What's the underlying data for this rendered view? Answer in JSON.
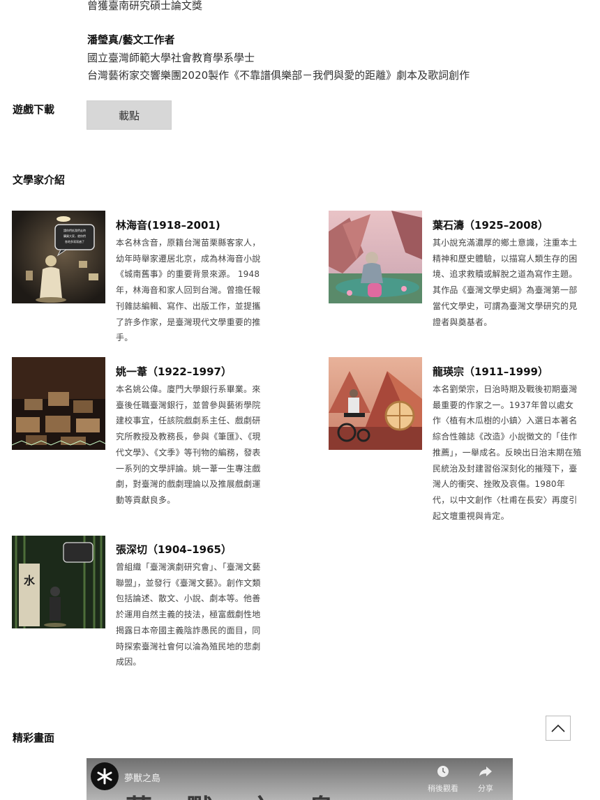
{
  "credits": {
    "line_award": "曾獲臺南研究碩士論文獎",
    "person2_name": "潘瑩真/藝文工作者",
    "person2_line1": "國立臺灣師範大學社會教育學系學士",
    "person2_line2": "台灣藝術家交響樂團2020製作《不靠譜俱樂部－我們與愛的距離》劇本及歌詞創作"
  },
  "download": {
    "label": "遊戲下載",
    "button_label": "載點"
  },
  "authors_section": {
    "title": "文學家介紹",
    "authors": [
      {
        "name": "林海音(1918–2001)",
        "desc": "本名林含音，原籍台灣苗栗縣客家人，幼年時舉家遷居北京，成為林海音小說《城南舊事》的重要背景來源。 1948年，林海音和家人回到台灣。曾擔任報刊雜誌編輯、寫作、出版工作，並提攜了許多作家，是臺灣現代文學重要的推手。"
      },
      {
        "name": "葉石濤（1925–2008）",
        "desc": "其小說充滿濃厚的鄉土意識，注重本土精神和歷史體驗，以描寫人類生存的困境、追求救贖或解脫之道為寫作主題。其作品《臺灣文學史綱》為臺灣第一部當代文學史，可謂為臺灣文學研究的見證者與奠基者。"
      },
      {
        "name": "姚一葦（1922–1997）",
        "desc": "本名姚公偉。廈門大學銀行系畢業。來臺後任職臺灣銀行，並曾參與藝術學院建校事宜，任該院戲劇系主任、戲劇研究所教授及教務長，參與《筆匯》、《現代文學》、《文季》等刊物的編務，發表一系列的文學評論。姚一葦一生專注戲劇，對臺灣的戲劇理論以及推展戲劇運動等貢獻良多。"
      },
      {
        "name": "龍瑛宗（1911–1999）",
        "desc": "本名劉榮宗，日治時期及戰後初期臺灣最重要的作家之一。1937年曾以處女作〈植有木瓜樹的小鎮〉入選日本著名綜合性雜誌《改造》小說徵文的「佳作推薦」，一舉成名。反映出日治末期在殖民統治及封建習俗深刻化的摧殘下，臺灣人的衝突、挫敗及哀傷。1980年代，以中文創作〈杜甫在長安〉再度引起文壇重視與肯定。"
      },
      {
        "name": "張深切（1904–1965）",
        "desc": "曾組織「臺灣演劇研究會」、「臺灣文藝聯盟」，並發行《臺灣文藝》。創作文類包括論述、散文、小說、劇本等。他善於運用自然主義的技法，極富戲劇性地揭露日本帝國主義陰詐愚民的面目，同時探索臺灣社會何以淪為殖民地的悲劇成因。"
      }
    ],
    "thumb_bubble_1": "請你們抵我們走時購買大家，就你們各地多寫寫遍了很多時間。",
    "thumb_bubble_5": "水"
  },
  "gallery": {
    "title": "精彩畫面"
  },
  "video": {
    "title": "夢獸之島",
    "watch_later": "稍後觀看",
    "share": "分享",
    "big_text": "夢 獸 之 島"
  },
  "icons": {
    "back_to_top": "chevron-up-icon",
    "watch_later": "clock-icon",
    "share": "share-icon",
    "channel": "channel-logo-icon"
  }
}
